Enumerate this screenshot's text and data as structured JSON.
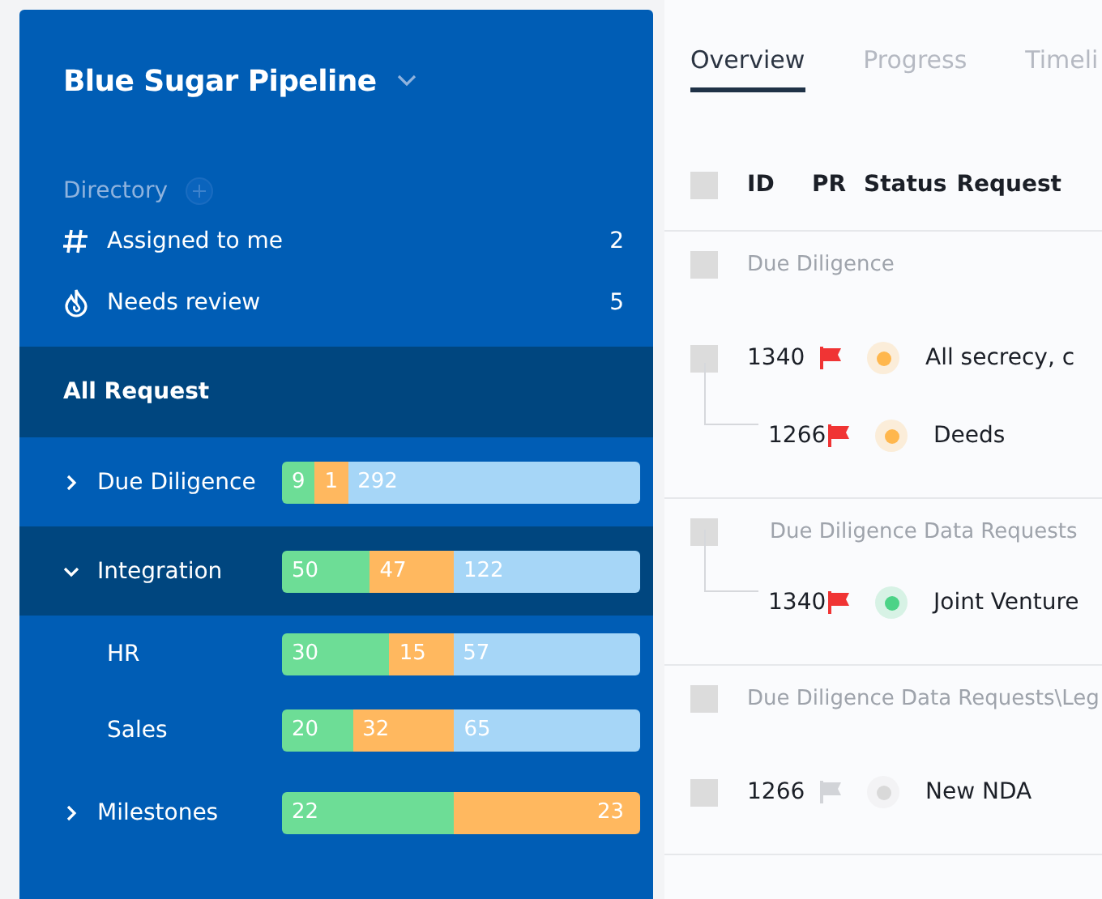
{
  "sidebar": {
    "title": "Blue Sugar Pipeline",
    "directory": {
      "label": "Directory",
      "items": [
        {
          "kind": "hash",
          "label": "Assigned to me",
          "count": "2"
        },
        {
          "kind": "fire",
          "label": "Needs review",
          "count": "5"
        }
      ]
    },
    "section_title": "All Request",
    "groups": [
      {
        "label": "Due Diligence",
        "expanded": false,
        "selected": false,
        "segments": [
          {
            "kind": "done",
            "value": "9"
          },
          {
            "kind": "active",
            "value": "1"
          },
          {
            "kind": "open",
            "value": "292"
          }
        ]
      },
      {
        "label": "Integration",
        "expanded": true,
        "selected": true,
        "segments": [
          {
            "kind": "done",
            "value": "50"
          },
          {
            "kind": "active",
            "value": "47"
          },
          {
            "kind": "open",
            "value": "122"
          }
        ],
        "children": [
          {
            "label": "HR",
            "segments": [
              {
                "kind": "done",
                "value": "30"
              },
              {
                "kind": "active",
                "value": "15"
              },
              {
                "kind": "open",
                "value": "57"
              }
            ]
          },
          {
            "label": "Sales",
            "segments": [
              {
                "kind": "done",
                "value": "20"
              },
              {
                "kind": "active",
                "value": "32"
              },
              {
                "kind": "open",
                "value": "65"
              }
            ]
          }
        ]
      },
      {
        "label": "Milestones",
        "expanded": false,
        "selected": false,
        "segments": [
          {
            "kind": "done",
            "value": "22"
          },
          {
            "kind": "active",
            "value": "23"
          }
        ]
      }
    ]
  },
  "tabs": [
    {
      "label": "Overview",
      "selected": true
    },
    {
      "label": "Progress",
      "selected": false
    },
    {
      "label": "Timeli",
      "selected": false
    }
  ],
  "table": {
    "all_checked": false,
    "columns": [
      "ID",
      "PR",
      "Status",
      "Request"
    ],
    "groups": [
      {
        "label": "Due Diligence",
        "checked": false,
        "items": [
          {
            "id": "1340",
            "checked": false,
            "flagged": true,
            "color": "#ffb74d",
            "request": "All secrecy, c",
            "children": [
              {
                "id": "1266",
                "flagged": true,
                "color": "#ffb74d",
                "request": "Deeds"
              }
            ]
          }
        ]
      },
      {
        "label": "Due Diligence Data Requests",
        "checked": false,
        "children": [
          {
            "id": "1340",
            "flagged": true,
            "color": "#4cd387",
            "request": "Joint Venture"
          }
        ]
      },
      {
        "label": "Due Diligence Data Requests\\Leg",
        "checked": false,
        "items": [
          {
            "id": "1266",
            "checked": false,
            "flagged": false,
            "color": "#d9d9d9",
            "request": "New NDA"
          }
        ]
      }
    ]
  }
}
